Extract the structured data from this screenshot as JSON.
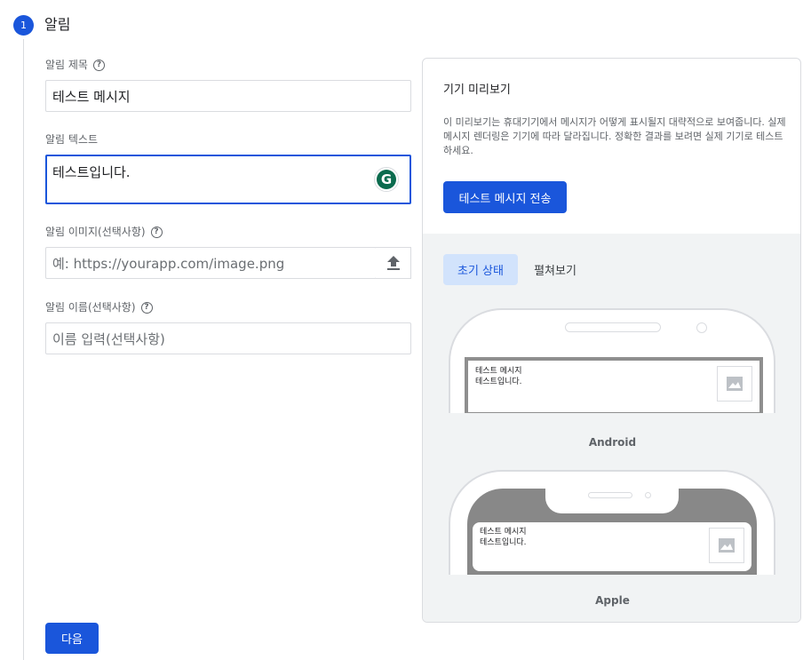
{
  "step": {
    "number": "1",
    "title": "알림"
  },
  "form": {
    "title_label": "알림 제목",
    "title_value": "테스트 메시지",
    "text_label": "알림 텍스트",
    "text_value": "테스트입니다.",
    "image_label": "알림 이미지(선택사항)",
    "image_placeholder": "예: https://yourapp.com/image.png",
    "name_label": "알림 이름(선택사항)",
    "name_placeholder": "이름 입력(선택사항)",
    "help_symbol": "?",
    "grammarly_letter": "G",
    "next_label": "다음"
  },
  "preview": {
    "title": "기기 미리보기",
    "description": "이 미리보기는 휴대기기에서 메시지가 어떻게 표시될지 대략적으로 보여줍니다. 실제 메시지 렌더링은 기기에 따라 달라집니다. 정확한 결과를 보려면 실제 기기로 테스트하세요.",
    "send_button": "테스트 메시지 전송",
    "tabs": [
      {
        "label": "초기 상태",
        "active": true
      },
      {
        "label": "펼쳐보기",
        "active": false
      }
    ],
    "devices": [
      {
        "label": "Android",
        "notif_title": "테스트 메시지",
        "notif_text": "테스트입니다."
      },
      {
        "label": "Apple",
        "notif_title": "테스트 메시지",
        "notif_text": "테스트입니다."
      }
    ]
  },
  "colors": {
    "accent": "#1a56db",
    "active_tab_bg": "#d2e3fc",
    "preview_bg": "#f1f3f4",
    "grammarly": "#0b6b4e"
  },
  "icons": {
    "help": "help-circle-icon",
    "upload": "upload-icon",
    "image_placeholder": "image-icon",
    "grammarly": "grammarly-icon"
  }
}
